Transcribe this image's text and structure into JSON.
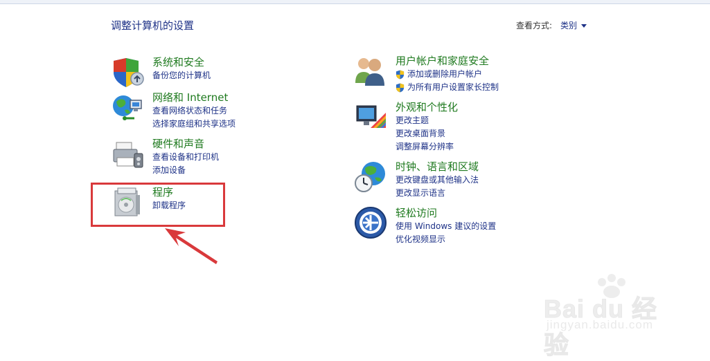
{
  "page_title": "调整计算机的设置",
  "view_by": {
    "label": "查看方式:",
    "value": "类别"
  },
  "left_categories": [
    {
      "title": "系统和安全",
      "links": [
        "备份您的计算机"
      ]
    },
    {
      "title": "网络和 Internet",
      "links": [
        "查看网络状态和任务",
        "选择家庭组和共享选项"
      ]
    },
    {
      "title": "硬件和声音",
      "links": [
        "查看设备和打印机",
        "添加设备"
      ]
    },
    {
      "title": "程序",
      "links": [
        "卸载程序"
      ]
    }
  ],
  "right_categories": [
    {
      "title": "用户帐户和家庭安全",
      "links": [
        "添加或删除用户帐户",
        "为所有用户设置家长控制"
      ]
    },
    {
      "title": "外观和个性化",
      "links": [
        "更改主题",
        "更改桌面背景",
        "调整屏幕分辨率"
      ]
    },
    {
      "title": "时钟、语言和区域",
      "links": [
        "更改键盘或其他输入法",
        "更改显示语言"
      ]
    },
    {
      "title": "轻松访问",
      "links": [
        "使用 Windows 建议的设置",
        "优化视频显示"
      ]
    }
  ],
  "watermark": {
    "brand": "Bai du 经验",
    "sub": "jingyan.baidu.com"
  },
  "colors": {
    "title_green": "#1f7a1f",
    "link_blue": "#1e3287",
    "highlight_red": "#d9393b"
  }
}
